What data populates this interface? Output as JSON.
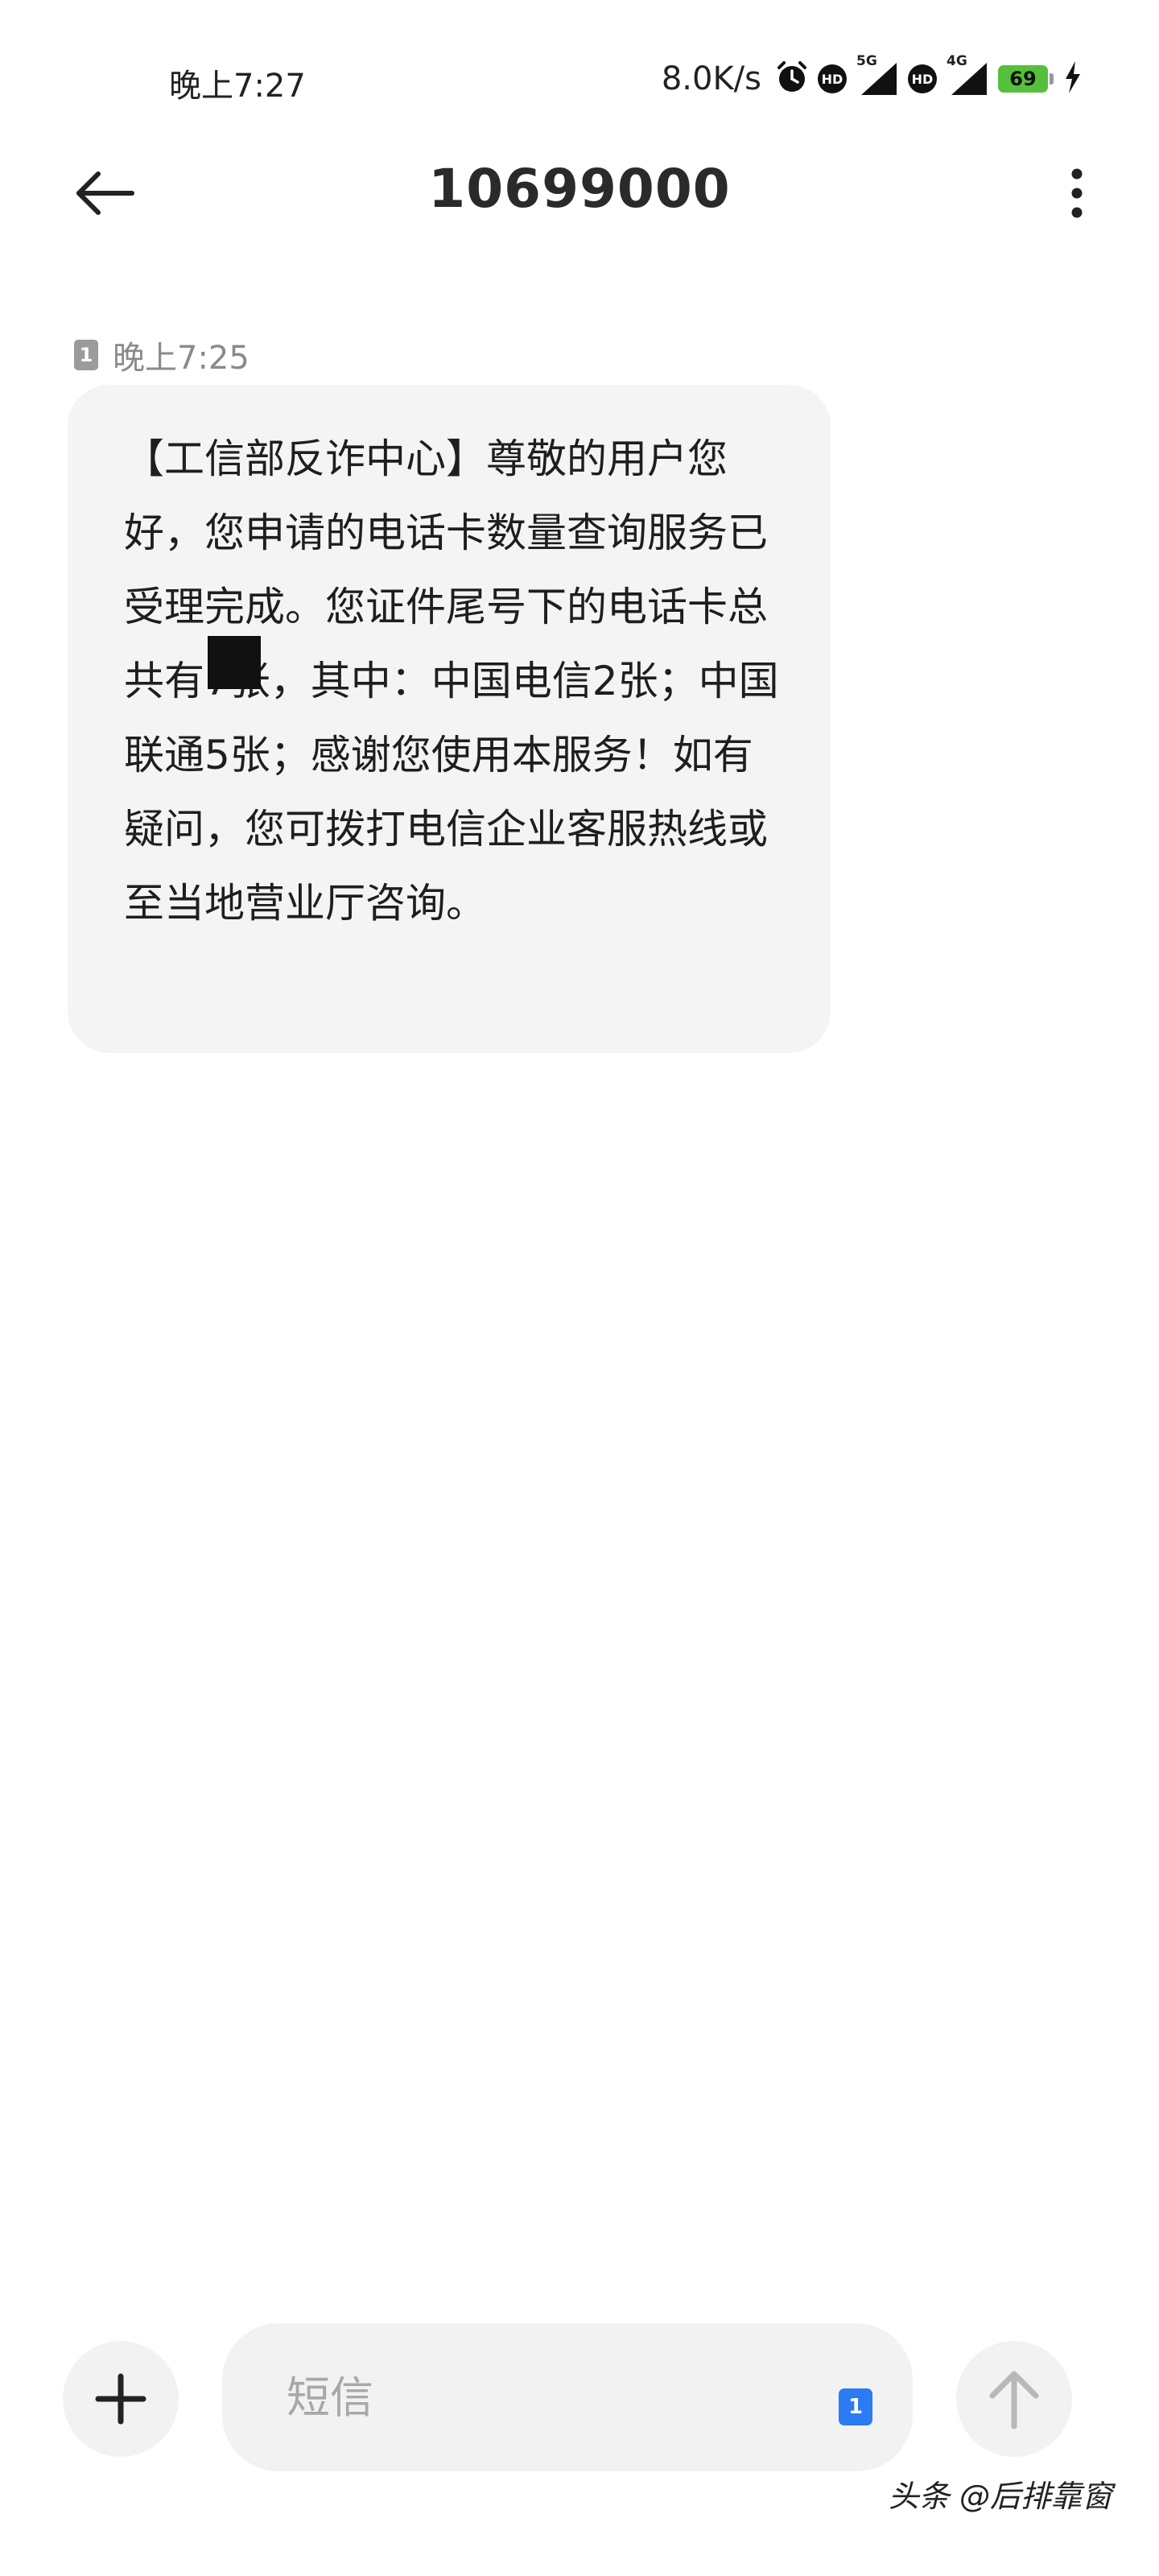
{
  "status_bar": {
    "time": "晚上7:27",
    "net_speed": "8.0K/s",
    "sim1_network": "5G",
    "sim2_network": "4G",
    "hd_label": "HD",
    "battery": "69",
    "icons": [
      "alarm-icon",
      "hd-icon",
      "signal-icon",
      "hd-icon",
      "signal-icon",
      "battery-icon",
      "charging-icon"
    ]
  },
  "header": {
    "title": "10699000",
    "back_icon": "arrow-left-icon",
    "more_icon": "more-vertical-icon"
  },
  "conversation": {
    "messages": [
      {
        "sim": "1",
        "time": "晚上7:25",
        "text": "【工信部反诈中心】尊敬的用户您好，您申请的电话卡数量查询服务已受理完成。您证件尾号下的电话卡总共有7张，其中：中国电信2张；中国联通5张；感谢您使用本服务！如有疑问，您可拨打电信企业客服热线或至当地营业厅咨询。"
      }
    ]
  },
  "composer": {
    "placeholder": "短信",
    "sim_selector": "1",
    "add_icon": "plus-icon",
    "send_icon": "arrow-up-icon"
  },
  "watermark": "头条 @后排靠窗",
  "colors": {
    "bubble_bg": "#f4f4f4",
    "sim_selector_bg": "#2c7bf2",
    "battery_green": "#55c03a"
  }
}
